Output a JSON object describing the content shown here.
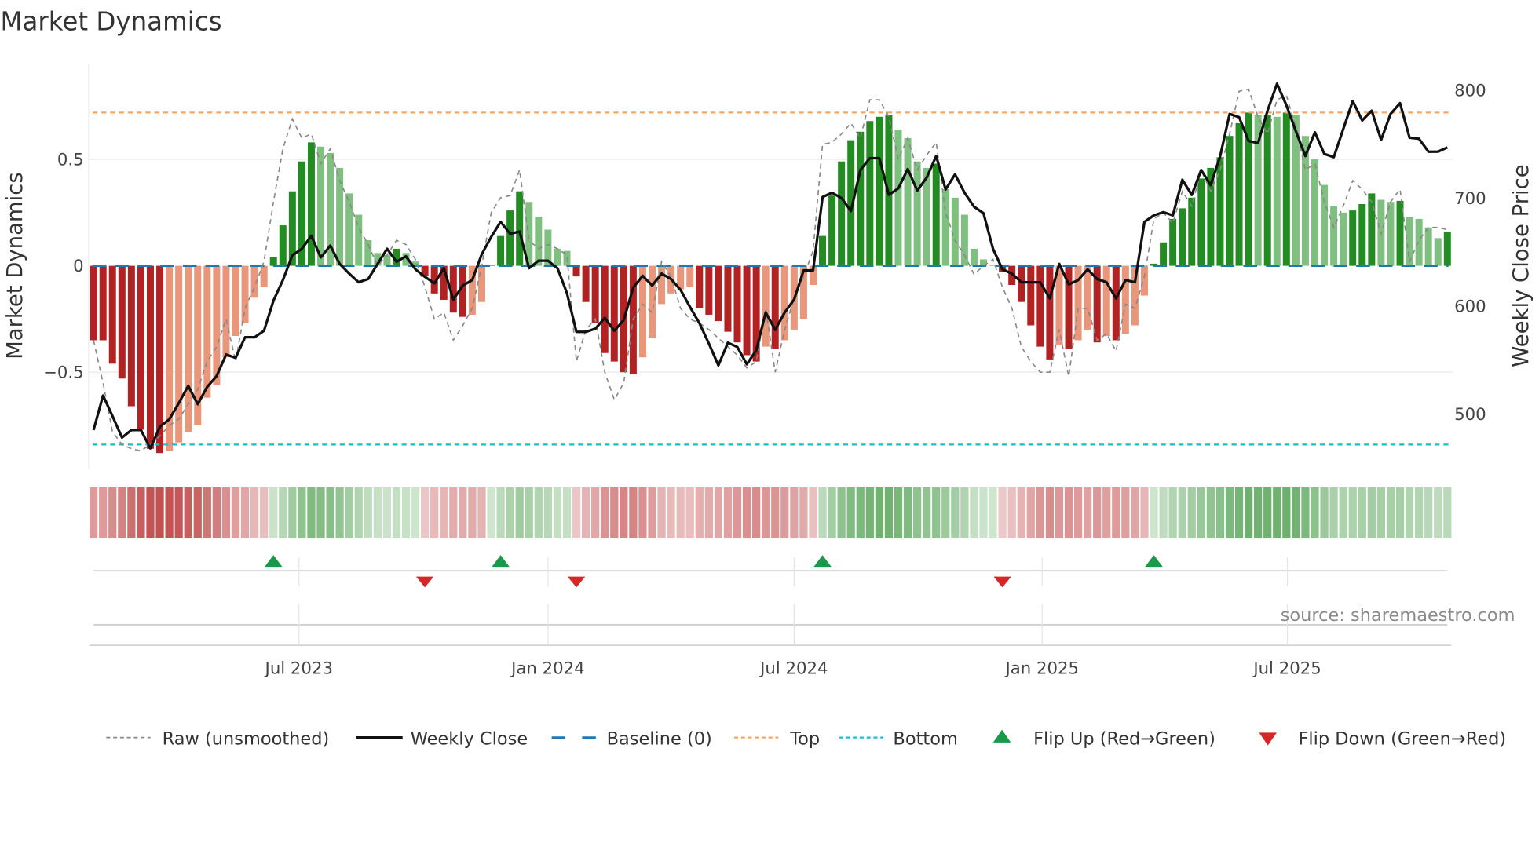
{
  "title": "Market Dynamics",
  "source": "source: sharemaestro.com",
  "colors": {
    "up_strong": "#228b22",
    "up_weak": "#7fbf7f",
    "down_strong": "#b22222",
    "down_weak": "#e9967a",
    "close": "#111111",
    "raw": "#888888",
    "baseline": "#1f77b4",
    "top": "#f0a868",
    "bottom": "#17becf",
    "flip_up": "#1a9a48",
    "flip_down": "#d62728"
  },
  "chart_data": {
    "type": "bar",
    "title": "Market Dynamics",
    "ylabel": "Market Dynamics",
    "y2label": "Weekly Close Price",
    "ylim": [
      -0.92,
      0.96
    ],
    "y2lim": [
      455,
      825
    ],
    "yticks": [
      {
        "v": 0.5,
        "label": "0.5"
      },
      {
        "v": 0,
        "label": "0"
      },
      {
        "v": -0.5,
        "label": "−0.5"
      }
    ],
    "y2ticks": [
      {
        "v": 800,
        "label": "800"
      },
      {
        "v": 700,
        "label": "700"
      },
      {
        "v": 600,
        "label": "600"
      },
      {
        "v": 500,
        "label": "500"
      }
    ],
    "xticks": [
      {
        "week_index": 21.7,
        "label": "Jul 2023"
      },
      {
        "week_index": 48.0,
        "label": "Jan 2024"
      },
      {
        "week_index": 74.0,
        "label": "Jul 2024"
      },
      {
        "week_index": 100.2,
        "label": "Jan 2025"
      },
      {
        "week_index": 126.1,
        "label": "Jul 2025"
      }
    ],
    "grid": true,
    "top_level": 0.72,
    "bottom_level": -0.84,
    "baseline": 0,
    "momentum": [
      -0.35,
      -0.35,
      -0.46,
      -0.53,
      -0.66,
      -0.77,
      -0.86,
      -0.88,
      -0.87,
      -0.83,
      -0.78,
      -0.75,
      -0.62,
      -0.56,
      -0.43,
      -0.33,
      -0.27,
      -0.15,
      -0.1,
      0.04,
      0.19,
      0.35,
      0.49,
      0.58,
      0.56,
      0.53,
      0.46,
      0.34,
      0.24,
      0.12,
      0.06,
      0.05,
      0.08,
      0.06,
      0.02,
      -0.05,
      -0.13,
      -0.16,
      -0.22,
      -0.24,
      -0.23,
      -0.17,
      0.005,
      0.14,
      0.26,
      0.35,
      0.3,
      0.23,
      0.17,
      0.08,
      0.07,
      -0.05,
      -0.17,
      -0.27,
      -0.41,
      -0.45,
      -0.5,
      -0.51,
      -0.43,
      -0.34,
      -0.18,
      -0.13,
      -0.11,
      -0.1,
      -0.2,
      -0.23,
      -0.26,
      -0.31,
      -0.36,
      -0.42,
      -0.45,
      -0.38,
      -0.39,
      -0.35,
      -0.3,
      -0.25,
      -0.09,
      0.14,
      0.33,
      0.49,
      0.59,
      0.63,
      0.68,
      0.7,
      0.71,
      0.64,
      0.6,
      0.49,
      0.46,
      0.48,
      0.36,
      0.32,
      0.24,
      0.08,
      0.03,
      0.005,
      -0.03,
      -0.09,
      -0.17,
      -0.28,
      -0.38,
      -0.44,
      -0.37,
      -0.39,
      -0.35,
      -0.3,
      -0.36,
      -0.33,
      -0.35,
      -0.32,
      -0.28,
      -0.14,
      0.01,
      0.11,
      0.22,
      0.27,
      0.32,
      0.41,
      0.46,
      0.51,
      0.61,
      0.67,
      0.72,
      0.71,
      0.71,
      0.7,
      0.72,
      0.71,
      0.61,
      0.5,
      0.38,
      0.28,
      0.25,
      0.26,
      0.29,
      0.34,
      0.31,
      0.3,
      0.305,
      0.23,
      0.22,
      0.18,
      0.13,
      0.16
    ],
    "raw": [
      -0.35,
      -0.55,
      -0.78,
      -0.84,
      -0.86,
      -0.87,
      -0.84,
      -0.8,
      -0.75,
      -0.72,
      -0.65,
      -0.58,
      -0.45,
      -0.38,
      -0.25,
      -0.45,
      -0.2,
      -0.1,
      0.02,
      0.3,
      0.55,
      0.69,
      0.6,
      0.62,
      0.48,
      0.55,
      0.4,
      0.3,
      0.18,
      0.1,
      0.0,
      0.05,
      0.12,
      0.1,
      0.03,
      -0.1,
      -0.25,
      -0.22,
      -0.35,
      -0.28,
      -0.2,
      0.0,
      0.25,
      0.32,
      0.33,
      0.45,
      0.12,
      0.08,
      0.1,
      0.08,
      0.05,
      -0.45,
      -0.3,
      -0.25,
      -0.5,
      -0.63,
      -0.55,
      -0.25,
      -0.18,
      -0.22,
      0.02,
      -0.05,
      -0.2,
      -0.25,
      -0.27,
      -0.3,
      -0.34,
      -0.38,
      -0.42,
      -0.48,
      -0.45,
      -0.2,
      -0.5,
      -0.3,
      -0.15,
      -0.05,
      0.07,
      0.57,
      0.58,
      0.62,
      0.67,
      0.6,
      0.78,
      0.78,
      0.7,
      0.5,
      0.6,
      0.45,
      0.52,
      0.58,
      0.25,
      0.12,
      0.05,
      -0.04,
      0.0,
      0.03,
      -0.1,
      -0.2,
      -0.38,
      -0.45,
      -0.5,
      -0.5,
      -0.3,
      -0.52,
      -0.2,
      -0.2,
      -0.35,
      -0.32,
      -0.4,
      -0.18,
      -0.2,
      -0.05,
      0.22,
      0.25,
      0.2,
      0.35,
      0.28,
      0.45,
      0.35,
      0.45,
      0.62,
      0.82,
      0.83,
      0.7,
      0.62,
      0.78,
      0.8,
      0.65,
      0.45,
      0.48,
      0.3,
      0.18,
      0.28,
      0.4,
      0.36,
      0.3,
      0.15,
      0.3,
      0.36,
      0.02,
      0.12,
      0.18,
      0.18,
      0.17
    ],
    "weekly_close": [
      485,
      517,
      498,
      478,
      485,
      485,
      468,
      488,
      495,
      510,
      526,
      509,
      525,
      535,
      555,
      552,
      571,
      571,
      577,
      605,
      624,
      647,
      653,
      665,
      645,
      656,
      639,
      630,
      622,
      625,
      639,
      653,
      641,
      646,
      634,
      627,
      621,
      635,
      606,
      619,
      624,
      648,
      664,
      678,
      667,
      669,
      635,
      642,
      642,
      635,
      612,
      576,
      576,
      579,
      589,
      577,
      587,
      617,
      628,
      619,
      630,
      625,
      615,
      599,
      584,
      565,
      545,
      566,
      562,
      546,
      559,
      594,
      578,
      594,
      606,
      633,
      633,
      701,
      705,
      700,
      688,
      726,
      737,
      737,
      703,
      709,
      727,
      707,
      719,
      739,
      708,
      722,
      705,
      692,
      686,
      653,
      634,
      630,
      622,
      622,
      622,
      607,
      639,
      620,
      624,
      634,
      625,
      622,
      607,
      624,
      622,
      678,
      684,
      687,
      684,
      717,
      703,
      726,
      712,
      739,
      778,
      775,
      753,
      751,
      781,
      806,
      786,
      762,
      739,
      761,
      741,
      738,
      764,
      790,
      772,
      781,
      754,
      778,
      788,
      756,
      755,
      743,
      743,
      747
    ],
    "flips": [
      {
        "week_index": 19,
        "type": "up"
      },
      {
        "week_index": 35,
        "type": "down"
      },
      {
        "week_index": 43,
        "type": "up"
      },
      {
        "week_index": 51,
        "type": "down"
      },
      {
        "week_index": 77,
        "type": "up"
      },
      {
        "week_index": 96,
        "type": "down"
      },
      {
        "week_index": 112,
        "type": "up"
      }
    ],
    "legend_position": "bottom",
    "legend": [
      {
        "key": "raw",
        "label": "Raw (unsmoothed)"
      },
      {
        "key": "close",
        "label": "Weekly Close"
      },
      {
        "key": "baseline",
        "label": "Baseline (0)"
      },
      {
        "key": "top",
        "label": "Top"
      },
      {
        "key": "bottom",
        "label": "Bottom"
      },
      {
        "key": "flip_up",
        "label": "Flip Up (Red→Green)"
      },
      {
        "key": "flip_down",
        "label": "Flip Down (Green→Red)"
      }
    ]
  }
}
